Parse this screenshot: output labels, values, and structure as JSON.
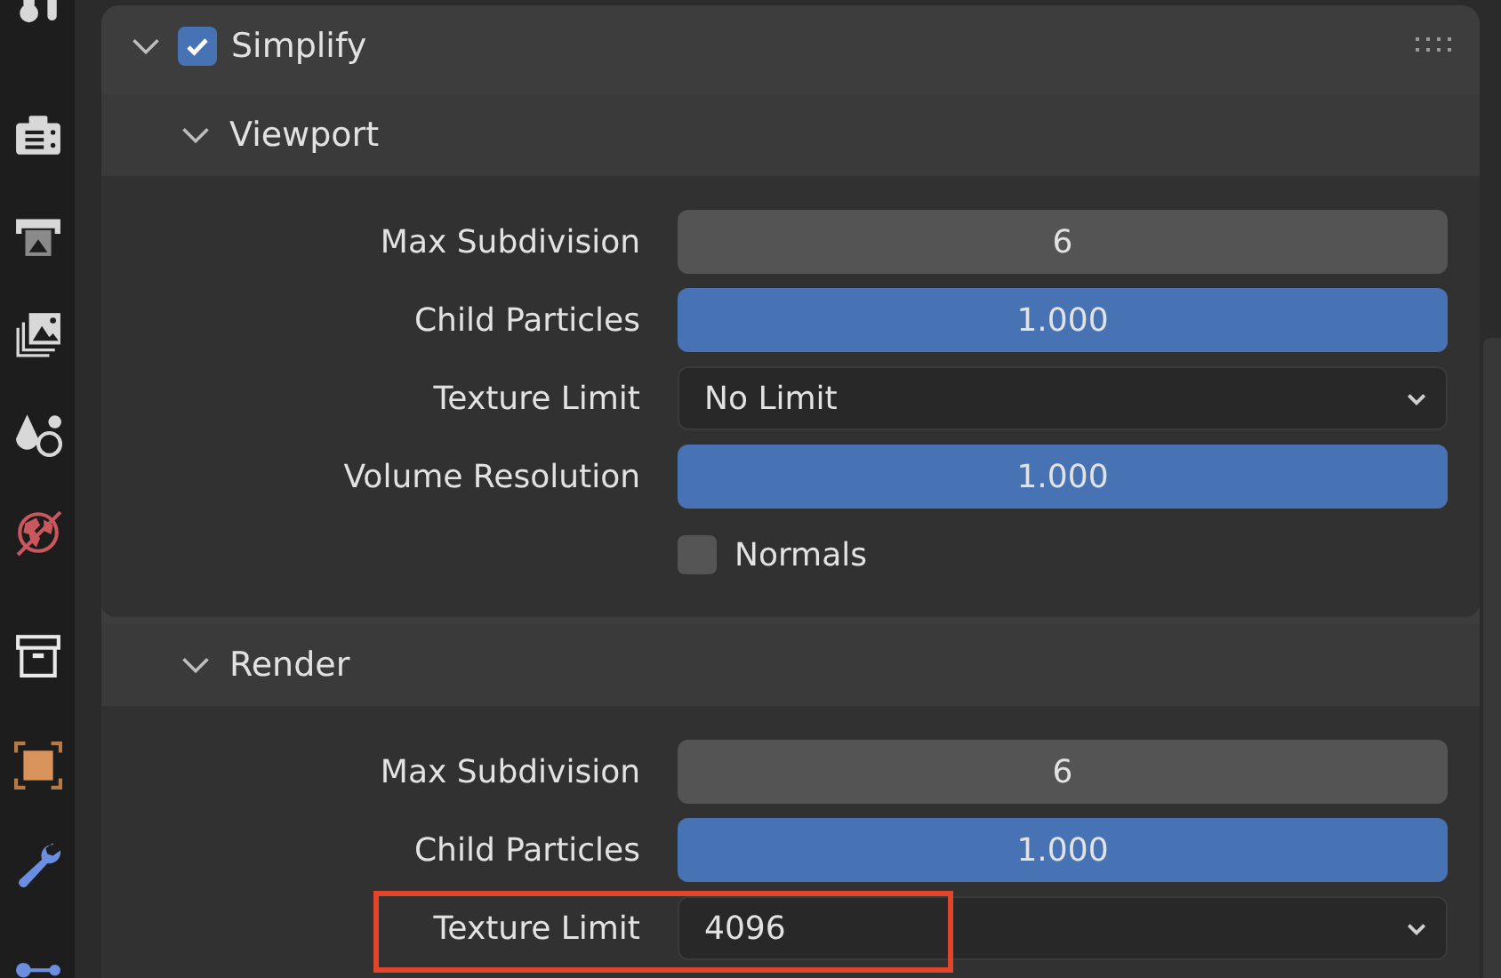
{
  "sidebar": {
    "tabs": [
      {
        "kind": "tool"
      },
      {
        "kind": "render"
      },
      {
        "kind": "output"
      },
      {
        "kind": "view_layer"
      },
      {
        "kind": "scene"
      },
      {
        "kind": "world"
      },
      {
        "kind": "collection"
      },
      {
        "kind": "object"
      },
      {
        "kind": "modifier"
      },
      {
        "kind": "particles"
      }
    ]
  },
  "panel": {
    "title": "Simplify",
    "expanded": true,
    "enabled": true,
    "sections": [
      {
        "title": "Viewport",
        "expanded": true,
        "rows": [
          {
            "kind": "number",
            "label": "Max Subdivision",
            "value": "6"
          },
          {
            "kind": "slider",
            "label": "Child Particles",
            "value": "1.000",
            "level": 1
          },
          {
            "kind": "dropdown",
            "label": "Texture Limit",
            "value": "No Limit"
          },
          {
            "kind": "slider",
            "label": "Volume Resolution",
            "value": "1.000",
            "level": 1
          },
          {
            "kind": "checkbox",
            "label": "Normals",
            "checked": false
          }
        ]
      },
      {
        "title": "Render",
        "expanded": true,
        "rows": [
          {
            "kind": "number",
            "label": "Max Subdivision",
            "value": "6"
          },
          {
            "kind": "slider",
            "label": "Child Particles",
            "value": "1.000",
            "level": 1
          },
          {
            "kind": "dropdown",
            "label": "Texture Limit",
            "value": "4096",
            "highlighted": true
          }
        ]
      }
    ]
  }
}
